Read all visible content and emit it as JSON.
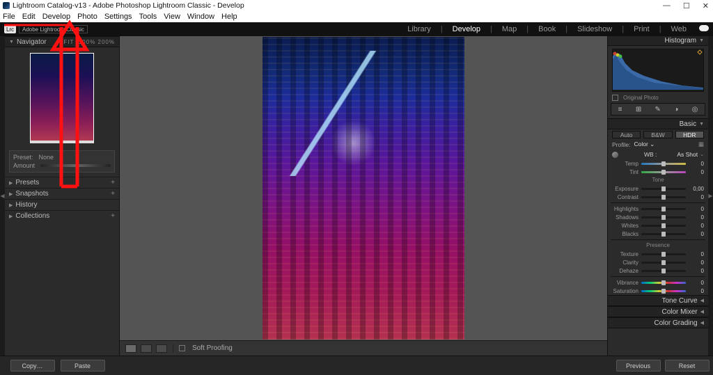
{
  "window": {
    "title": "Lightroom Catalog-v13 - Adobe Photoshop Lightroom Classic - Develop"
  },
  "menu": [
    "File",
    "Edit",
    "Develop",
    "Photo",
    "Settings",
    "Tools",
    "View",
    "Window",
    "Help"
  ],
  "topbar": {
    "chip": "Lrc",
    "crumb": "Adobe Lightroom Classic",
    "modules": [
      "Library",
      "Develop",
      "Map",
      "Book",
      "Slideshow",
      "Print",
      "Web"
    ],
    "active_module": "Develop"
  },
  "left": {
    "navigator": {
      "label": "Navigator",
      "zoom": "FIT",
      "levels": "100%   200%"
    },
    "preset_box": {
      "preset": "Preset:",
      "preset_val": "None",
      "amount": "Amount"
    },
    "accordions": [
      "Presets",
      "Snapshots",
      "History",
      "Collections"
    ]
  },
  "center": {
    "soft_proofing": "Soft Proofing",
    "buttons": {
      "copy": "Copy…",
      "paste": "Paste"
    },
    "nav_buttons": {
      "previous": "Previous",
      "reset": "Reset"
    }
  },
  "right": {
    "histogram": "Histogram",
    "original_photo": "Original Photo",
    "tools": [
      "≡",
      "⊞",
      "✎",
      "◑",
      "◎"
    ],
    "basic": {
      "title": "Basic",
      "treatment": {
        "auto": "Auto",
        "bw": "B&W",
        "hdr": "HDR"
      },
      "profile_label": "Profile:",
      "profile_value": "Color",
      "wb_label": "WB :",
      "wb_value": "As Shot",
      "sliders_wb": [
        {
          "name": "Temp",
          "val": "0",
          "track": "temp"
        },
        {
          "name": "Tint",
          "val": "0",
          "track": "tint"
        }
      ],
      "tone_label": "Tone",
      "sliders_tone": [
        {
          "name": "Exposure",
          "val": "0,00"
        },
        {
          "name": "Contrast",
          "val": "0"
        }
      ],
      "sliders_tone2": [
        {
          "name": "Highlights",
          "val": "0"
        },
        {
          "name": "Shadows",
          "val": "0"
        },
        {
          "name": "Whites",
          "val": "0"
        },
        {
          "name": "Blacks",
          "val": "0"
        }
      ],
      "presence_label": "Presence",
      "sliders_presence": [
        {
          "name": "Texture",
          "val": "0"
        },
        {
          "name": "Clarity",
          "val": "0"
        },
        {
          "name": "Dehaze",
          "val": "0"
        }
      ],
      "sliders_vib": [
        {
          "name": "Vibrance",
          "val": "0",
          "track": "rainbow"
        },
        {
          "name": "Saturation",
          "val": "0",
          "track": "rainbow"
        }
      ]
    },
    "collapsed": [
      "Tone Curve",
      "Color Mixer",
      "Color Grading"
    ]
  }
}
